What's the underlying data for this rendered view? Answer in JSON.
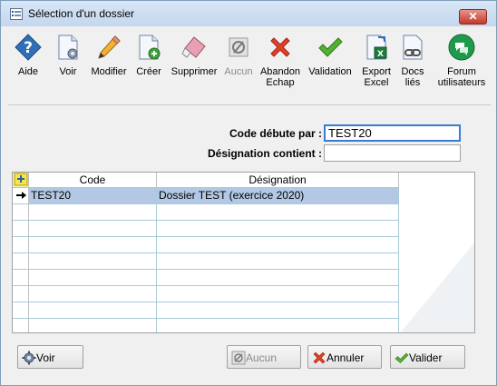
{
  "window": {
    "title": "Sélection d'un dossier",
    "close_label": "✕"
  },
  "toolbar": {
    "buttons": [
      {
        "label": "Aide",
        "icon": "help-icon",
        "enabled": true
      },
      {
        "label": "Voir",
        "icon": "view-document-icon",
        "enabled": true
      },
      {
        "label": "Modifier",
        "icon": "pencil-icon",
        "enabled": true
      },
      {
        "label": "Créer",
        "icon": "new-document-icon",
        "enabled": true
      },
      {
        "label": "Supprimer",
        "icon": "eraser-icon",
        "enabled": true
      },
      {
        "label": "Aucun",
        "icon": "empty-set-icon",
        "enabled": false
      },
      {
        "label": "Abandon\nEchap",
        "icon": "red-x-icon",
        "enabled": true
      },
      {
        "label": "Validation",
        "icon": "green-check-icon",
        "enabled": true
      },
      {
        "label": "Export\nExcel",
        "icon": "excel-export-icon",
        "enabled": true
      },
      {
        "label": "Docs\nliés",
        "icon": "linked-docs-icon",
        "enabled": true
      },
      {
        "label": "Forum\nutilisateurs",
        "icon": "forum-icon",
        "enabled": true
      }
    ]
  },
  "filters": {
    "code_label": "Code débute par :",
    "code_value": "TEST20",
    "designation_label": "Désignation contient :",
    "designation_value": ""
  },
  "grid": {
    "columns": [
      "Code",
      "Désignation"
    ],
    "rows": [
      {
        "code": "TEST20",
        "designation": "Dossier TEST (exercice 2020)",
        "selected": true
      },
      {
        "code": "",
        "designation": ""
      },
      {
        "code": "",
        "designation": ""
      },
      {
        "code": "",
        "designation": ""
      },
      {
        "code": "",
        "designation": ""
      },
      {
        "code": "",
        "designation": ""
      },
      {
        "code": "",
        "designation": ""
      },
      {
        "code": "",
        "designation": ""
      },
      {
        "code": "",
        "designation": ""
      }
    ]
  },
  "footer": {
    "voir_label": "Voir",
    "aucun_label": "Aucun",
    "annuler_label": "Annuler",
    "valider_label": "Valider"
  },
  "colors": {
    "accent": "#3a7bd5",
    "selection": "#b2c8e4",
    "gridline": "#a8cbd8"
  }
}
